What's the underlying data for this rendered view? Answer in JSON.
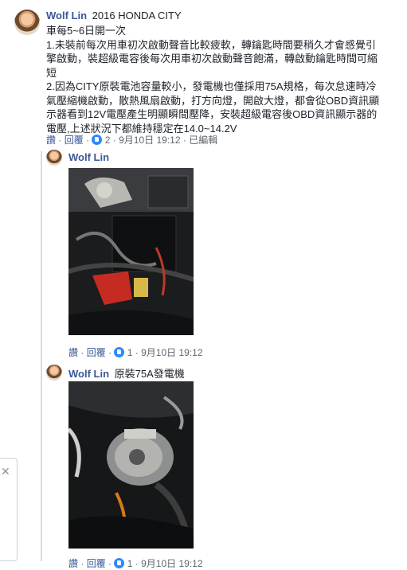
{
  "post": {
    "author": "Wolf Lin",
    "headline": "2016 HONDA CITY",
    "lines": [
      "車每5~6日開一次",
      "1.未裝前每次用車初次啟動聲音比較疲軟，轉鑰匙時間要稍久才會感覺引擎啟動，裝超級電容後每次用車初次啟動聲音飽滿，轉啟動鑰匙時間可縮短",
      "2.因為CITY原裝電池容量較小，發電機也僅採用75A規格，每次怠速時冷氣壓縮機啟動，散熱風扇啟動，打方向燈，開啟大燈，都會從OBD資訊顯示器看到12V電壓產生明顯瞬間壓降，安裝超級電容後OBD資訊顯示器的電壓,上述狀況下都維持穩定在14.0~14.2V"
    ],
    "actions": {
      "like": "讚",
      "reply": "回覆",
      "reactions": "2",
      "date": "9月10日 19:12",
      "edited": "已編輯"
    }
  },
  "replies": [
    {
      "author": "Wolf Lin",
      "text": "",
      "image": "engine-bay-photo",
      "actions": {
        "like": "讚",
        "reply": "回覆",
        "reactions": "1",
        "date": "9月10日 19:12"
      }
    },
    {
      "author": "Wolf Lin",
      "text": "原裝75A發電機",
      "image": "alternator-photo",
      "actions": {
        "like": "讚",
        "reply": "回覆",
        "reactions": "1",
        "date": "9月10日 19:12"
      }
    }
  ],
  "ui": {
    "separator": "·",
    "close_glyph": "✕"
  }
}
